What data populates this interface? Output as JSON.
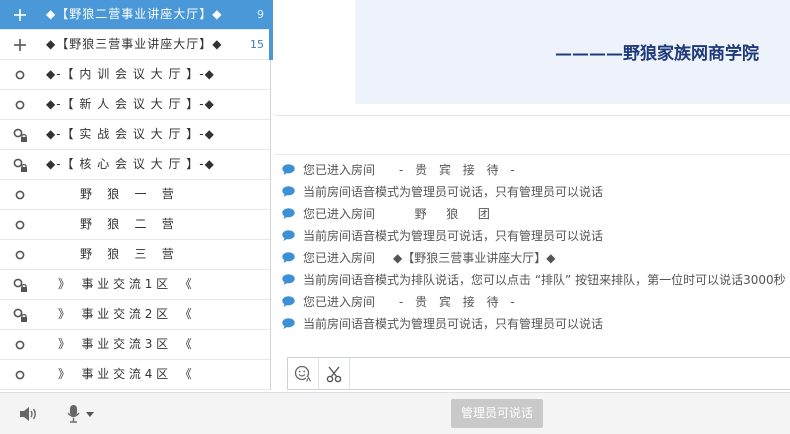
{
  "rooms": [
    {
      "icon": "plus-icon",
      "name": "◆【野狼二营事业讲座大厅】◆",
      "count": "9",
      "active": true,
      "style": ""
    },
    {
      "icon": "plus-icon",
      "name": "◆【野狼三营事业讲座大厅】◆",
      "count": "15",
      "active": false,
      "style": ""
    },
    {
      "icon": "circle-icon",
      "name": "◆-【 内 训 会 议 大 厅 】-◆",
      "count": "",
      "active": false,
      "style": ""
    },
    {
      "icon": "circle-icon",
      "name": "◆-【 新 人 会 议 大 厅 】-◆",
      "count": "",
      "active": false,
      "style": ""
    },
    {
      "icon": "locked-circle-icon",
      "name": "◆-【 实 战 会 议 大 厅 】-◆",
      "count": "",
      "active": false,
      "style": ""
    },
    {
      "icon": "locked-circle-icon",
      "name": "◆-【 核 心 会 议 大 厅 】-◆",
      "count": "",
      "active": false,
      "style": ""
    },
    {
      "icon": "circle-icon",
      "name": "野    狼    一    营",
      "count": "",
      "active": false,
      "style": "center"
    },
    {
      "icon": "circle-icon",
      "name": "野    狼    二    营",
      "count": "",
      "active": false,
      "style": "center"
    },
    {
      "icon": "circle-icon",
      "name": "野    狼    三    营",
      "count": "",
      "active": false,
      "style": "center"
    },
    {
      "icon": "locked-circle-icon",
      "name": "》   事 业 交 流 1 区   《",
      "count": "",
      "active": false,
      "style": "mid"
    },
    {
      "icon": "locked-circle-icon",
      "name": "》   事 业 交 流 2 区   《",
      "count": "",
      "active": false,
      "style": "mid"
    },
    {
      "icon": "circle-icon",
      "name": "》   事 业 交 流 3 区   《",
      "count": "",
      "active": false,
      "style": "mid"
    },
    {
      "icon": "circle-icon",
      "name": "》   事 业 交 流 4 区   《",
      "count": "",
      "active": false,
      "style": "mid"
    }
  ],
  "banner": {
    "title": "————野狼家族网商学院"
  },
  "messages": [
    {
      "text": "您已进入房间",
      "room": "- 贵 宾 接 待 -"
    },
    {
      "text": "当前房间语音模式为管理员可说话，只有管理员可以说话",
      "room": ""
    },
    {
      "text": "您已进入房间",
      "room": "  野  狼  团"
    },
    {
      "text": "当前房间语音模式为管理员可说话，只有管理员可以说话",
      "room": ""
    },
    {
      "text": "您已进入房间",
      "room": "◆【野狼三营事业讲座大厅】◆"
    },
    {
      "text": "当前房间语音模式为排队说话，您可以点击 “排队” 按钮来排队，第一位时可以说话3000秒",
      "room": ""
    },
    {
      "text": "您已进入房间",
      "room": "- 贵 宾 接 待 -"
    },
    {
      "text": "当前房间语音模式为管理员可说话，只有管理员可以说话",
      "room": ""
    }
  ],
  "input": {
    "value": "",
    "placeholder": ""
  },
  "bottom": {
    "speak_label": "管理员可说话"
  },
  "colors": {
    "accent": "#4a98d8",
    "message_icon": "#3d8fd6",
    "banner_bg": "#eef3fb",
    "banner_text": "#1f3a7a"
  }
}
